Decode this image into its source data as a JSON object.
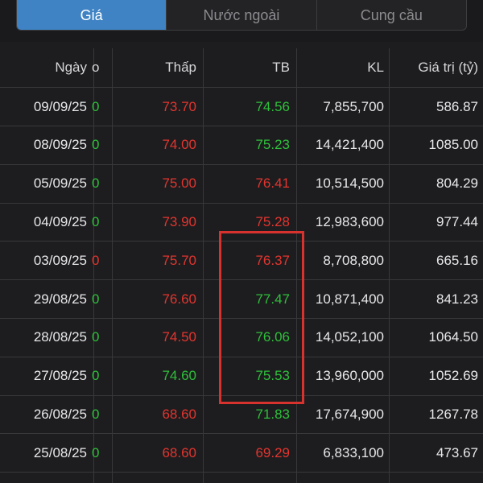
{
  "tabs": [
    {
      "label": "Giá",
      "active": true
    },
    {
      "label": "Nước ngoài",
      "active": false
    },
    {
      "label": "Cung cầu",
      "active": false
    }
  ],
  "columns": {
    "date": "Ngày",
    "clipped": "o",
    "low": "Thấp",
    "avg": "TB",
    "volume": "KL",
    "value": "Giá trị (tỷ)"
  },
  "rows": [
    {
      "date": "09/09/25",
      "clip": "0",
      "clip_color": "green",
      "low": "73.70",
      "low_color": "red",
      "avg": "74.56",
      "avg_color": "green",
      "volume": "7,855,700",
      "value": "586.87"
    },
    {
      "date": "08/09/25",
      "clip": "0",
      "clip_color": "green",
      "low": "74.00",
      "low_color": "red",
      "avg": "75.23",
      "avg_color": "green",
      "volume": "14,421,400",
      "value": "1085.00"
    },
    {
      "date": "05/09/25",
      "clip": "0",
      "clip_color": "green",
      "low": "75.00",
      "low_color": "red",
      "avg": "76.41",
      "avg_color": "red",
      "volume": "10,514,500",
      "value": "804.29"
    },
    {
      "date": "04/09/25",
      "clip": "0",
      "clip_color": "green",
      "low": "73.90",
      "low_color": "red",
      "avg": "75.28",
      "avg_color": "red",
      "volume": "12,983,600",
      "value": "977.44"
    },
    {
      "date": "03/09/25",
      "clip": "0",
      "clip_color": "red",
      "low": "75.70",
      "low_color": "red",
      "avg": "76.37",
      "avg_color": "red",
      "volume": "8,708,800",
      "value": "665.16"
    },
    {
      "date": "29/08/25",
      "clip": "0",
      "clip_color": "green",
      "low": "76.60",
      "low_color": "red",
      "avg": "77.47",
      "avg_color": "green",
      "volume": "10,871,400",
      "value": "841.23"
    },
    {
      "date": "28/08/25",
      "clip": "0",
      "clip_color": "green",
      "low": "74.50",
      "low_color": "red",
      "avg": "76.06",
      "avg_color": "green",
      "volume": "14,052,100",
      "value": "1064.50"
    },
    {
      "date": "27/08/25",
      "clip": "0",
      "clip_color": "green",
      "low": "74.60",
      "low_color": "green",
      "avg": "75.53",
      "avg_color": "green",
      "volume": "13,960,000",
      "value": "1052.69"
    },
    {
      "date": "26/08/25",
      "clip": "0",
      "clip_color": "green",
      "low": "68.60",
      "low_color": "red",
      "avg": "71.83",
      "avg_color": "green",
      "volume": "17,674,900",
      "value": "1267.78"
    },
    {
      "date": "25/08/25",
      "clip": "0",
      "clip_color": "green",
      "low": "68.60",
      "low_color": "red",
      "avg": "69.29",
      "avg_color": "red",
      "volume": "6,833,100",
      "value": "473.67"
    }
  ],
  "colors": {
    "background": "#1d1d1f",
    "active_tab": "#3f83c4",
    "up": "#2fbf3b",
    "down": "#e2352f",
    "highlight_box": "#d8322f"
  }
}
